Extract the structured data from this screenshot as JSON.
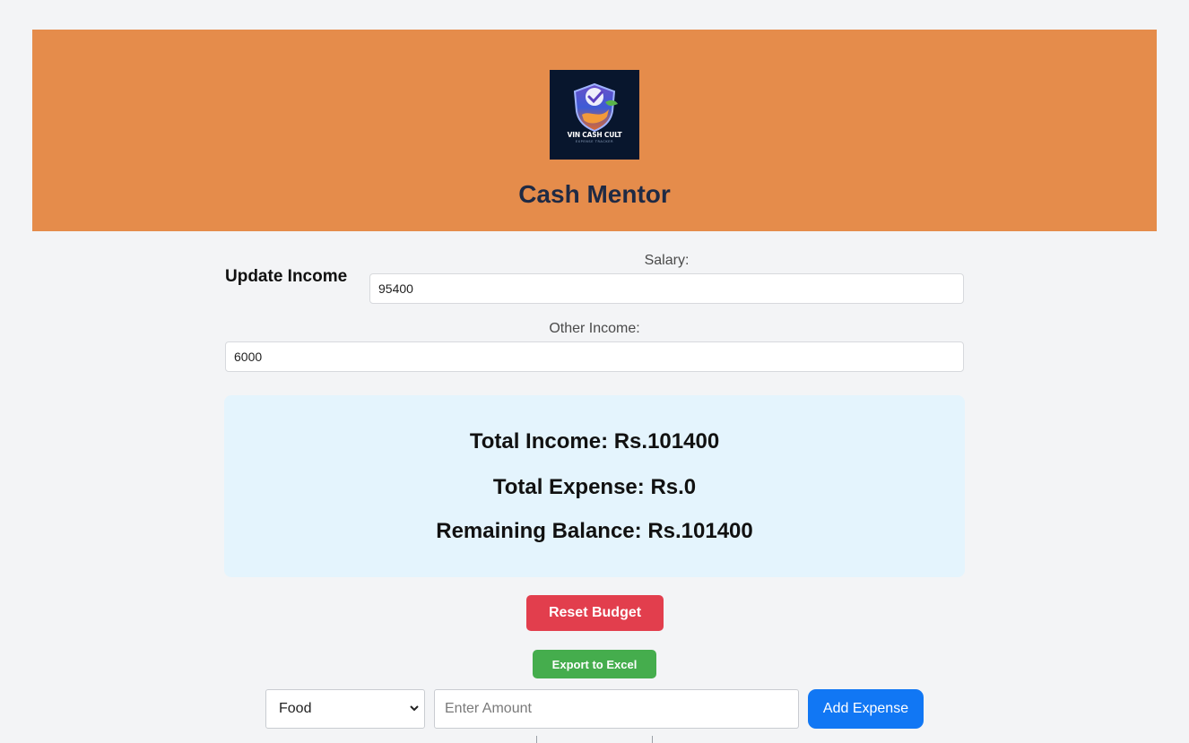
{
  "header": {
    "logo": {
      "brand_text": "VIN CASH CULT",
      "tagline": "EXPENSE TRACKER",
      "icon": "shield-check-logo-icon"
    },
    "title": "Cash Mentor",
    "background_color": "#e58c4b"
  },
  "income": {
    "section_label": "Update Income",
    "salary_label": "Salary:",
    "salary_value": "95400",
    "other_label": "Other Income:",
    "other_value": "6000"
  },
  "summary": {
    "total_income": "Total Income: Rs.101400",
    "total_expense": "Total Expense: Rs.0",
    "remaining_balance": "Remaining Balance: Rs.101400"
  },
  "actions": {
    "reset_label": "Reset Budget",
    "export_label": "Export to Excel"
  },
  "expense_form": {
    "category_selected": "Food",
    "amount_placeholder": "Enter Amount",
    "add_label": "Add Expense"
  },
  "colors": {
    "reset": "#e23e4d",
    "export": "#45ad4d",
    "add": "#1177f4",
    "summary_bg": "#e4f4fd"
  }
}
